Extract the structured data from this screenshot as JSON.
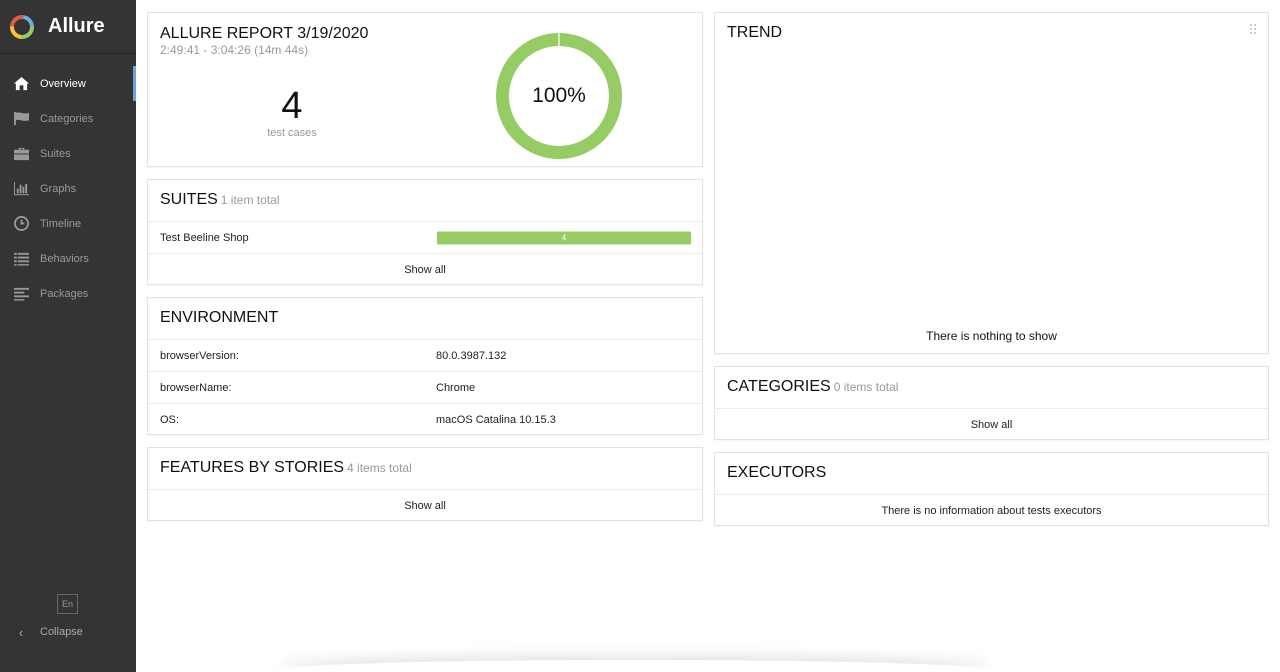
{
  "brand": {
    "name": "Allure",
    "logo_icon": "allure-logo-icon"
  },
  "sidebar": {
    "items": [
      {
        "label": "Overview",
        "icon": "home-icon",
        "active": true
      },
      {
        "label": "Categories",
        "icon": "flag-icon",
        "active": false
      },
      {
        "label": "Suites",
        "icon": "briefcase-icon",
        "active": false
      },
      {
        "label": "Graphs",
        "icon": "bar-chart-icon",
        "active": false
      },
      {
        "label": "Timeline",
        "icon": "clock-icon",
        "active": false
      },
      {
        "label": "Behaviors",
        "icon": "list-icon",
        "active": false
      },
      {
        "label": "Packages",
        "icon": "align-left-icon",
        "active": false
      }
    ],
    "language": "En",
    "collapse_label": "Collapse"
  },
  "summary": {
    "title": "ALLURE REPORT 3/19/2020",
    "time_range": "2:49:41 - 3:04:26 (14m 44s)",
    "count": "4",
    "count_label": "test cases",
    "percent_label": "100%",
    "pass_fraction": 1.0,
    "pass_color": "#97cc64"
  },
  "suites": {
    "title": "SUITES",
    "total": "1 item total",
    "rows": [
      {
        "name": "Test Beeline Shop",
        "count": "4"
      }
    ],
    "show_all": "Show all"
  },
  "environment": {
    "title": "ENVIRONMENT",
    "rows": [
      {
        "key": "browserVersion:",
        "value": "80.0.3987.132"
      },
      {
        "key": "browserName:",
        "value": "Chrome"
      },
      {
        "key": "OS:",
        "value": "macOS Catalina 10.15.3"
      }
    ]
  },
  "features": {
    "title": "FEATURES BY STORIES",
    "total": "4 items total",
    "show_all": "Show all"
  },
  "trend": {
    "title": "TREND",
    "empty": "There is nothing to show"
  },
  "categories": {
    "title": "CATEGORIES",
    "total": "0 items total",
    "show_all": "Show all"
  },
  "executors": {
    "title": "EXECUTORS",
    "empty": "There is no information about tests executors"
  }
}
